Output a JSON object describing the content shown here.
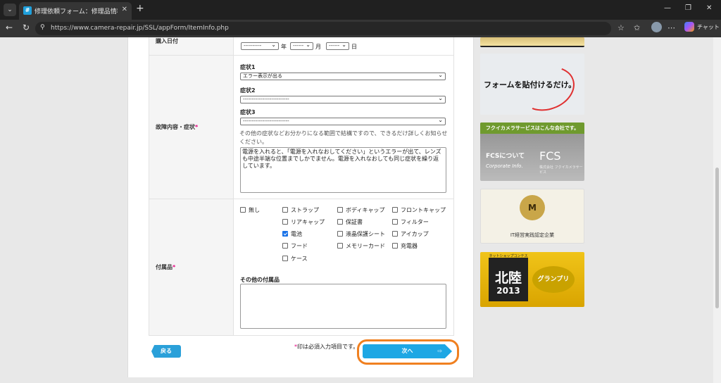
{
  "browser": {
    "tab_title": "修理依頼フォーム：修理品情報入力",
    "favicon_glyph": "#",
    "url": "https://www.camera-repair.jp/SSL/appForm/ItemInfo.php",
    "copilot_label": "チャット"
  },
  "form": {
    "purchase_date": {
      "label": "購入日付",
      "year_value": "----------",
      "year_unit": "年",
      "month_value": "------",
      "month_unit": "月",
      "day_value": "------",
      "day_unit": "日"
    },
    "symptoms": {
      "label": "故障内容・症状",
      "required_mark": "*",
      "symptom1_label": "症状1",
      "symptom1_value": "エラー表示が出る",
      "symptom2_label": "症状2",
      "symptom2_value": "--------------------------",
      "symptom3_label": "症状3",
      "symptom3_value": "--------------------------",
      "note": "その他の症状などお分かりになる範囲で結構ですので、できるだけ詳しくお知らせください。",
      "detail_text": "電源を入れると、「電源を入れなおしてください」というエラーが出て、レンズも中途半端な位置までしかでません。電源を入れなおしても同じ症状を繰り返しています。"
    },
    "accessories": {
      "label": "付属品",
      "required_mark": "*",
      "items": [
        {
          "label": "無し",
          "checked": false
        },
        {
          "label": "ストラップ",
          "checked": false
        },
        {
          "label": "ボディキャップ",
          "checked": false
        },
        {
          "label": "フロントキャップ",
          "checked": false
        },
        {
          "label": "リアキャップ",
          "checked": false
        },
        {
          "label": "保証書",
          "checked": false
        },
        {
          "label": "フィルター",
          "checked": false
        },
        {
          "label": "電池",
          "checked": true
        },
        {
          "label": "液晶保護シート",
          "checked": false
        },
        {
          "label": "アイカップ",
          "checked": false
        },
        {
          "label": "フード",
          "checked": false
        },
        {
          "label": "メモリーカード",
          "checked": false
        },
        {
          "label": "充電器",
          "checked": false
        },
        {
          "label": "ケース",
          "checked": false
        }
      ],
      "other_label": "その他の付属品",
      "other_value": ""
    },
    "required_note_mark": "*",
    "required_note": "印は必須入力項目です。",
    "back_label": "戻る",
    "next_label": "次へ",
    "next_arrow": "⇨"
  },
  "banners": {
    "form_banner": "フォームを貼付けるだけ。",
    "fcs_header": "フクイカメラサービスはこんな会社です。",
    "fcs_about": "FCSについて",
    "fcs_about_en": "Corporate Info.",
    "fcs_logo": "FCS",
    "fcs_company": "株式会社 フクイカメラサービス",
    "it_award_emblem": "M",
    "it_award": "IT経営実践認定企業",
    "contest_title": "ネットショップコンテスト",
    "contest_region": "北陸",
    "contest_year": "2013",
    "contest_prize": "グランプリ"
  },
  "colors": {
    "required": "#e4007f",
    "button": "#1ea7e4",
    "highlight": "#f08020"
  }
}
